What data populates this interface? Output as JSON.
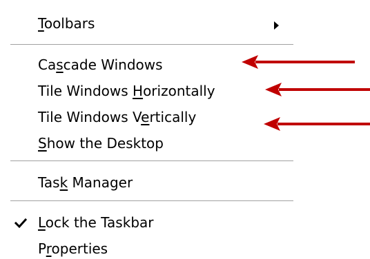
{
  "context_menu": {
    "items": [
      {
        "name": "toolbars",
        "before": "",
        "accel": "T",
        "after": "oolbars",
        "has_submenu": true
      },
      {
        "name": "cascade-windows",
        "before": "Ca",
        "accel": "s",
        "after": "cade Windows"
      },
      {
        "name": "tile-windows-horizontally",
        "before": "Tile Windows ",
        "accel": "H",
        "after": "orizontally"
      },
      {
        "name": "tile-windows-vertically",
        "before": "Tile Windows V",
        "accel": "e",
        "after": "rtically"
      },
      {
        "name": "show-the-desktop",
        "before": "",
        "accel": "S",
        "after": "how the Desktop"
      },
      {
        "name": "task-manager",
        "before": "Tas",
        "accel": "k",
        "after": " Manager"
      },
      {
        "name": "lock-the-taskbar",
        "before": "",
        "accel": "L",
        "after": "ock the Taskbar",
        "checked": true
      },
      {
        "name": "properties",
        "before": "P",
        "accel": "r",
        "after": "operties"
      }
    ]
  },
  "icons": {
    "submenu": "chevron-right-icon",
    "check": "checkmark-icon",
    "annotation": "red-arrow-icon"
  },
  "colors": {
    "annotation_arrow": "#c00000",
    "separator": "#a0a0a0",
    "text": "#000000"
  }
}
